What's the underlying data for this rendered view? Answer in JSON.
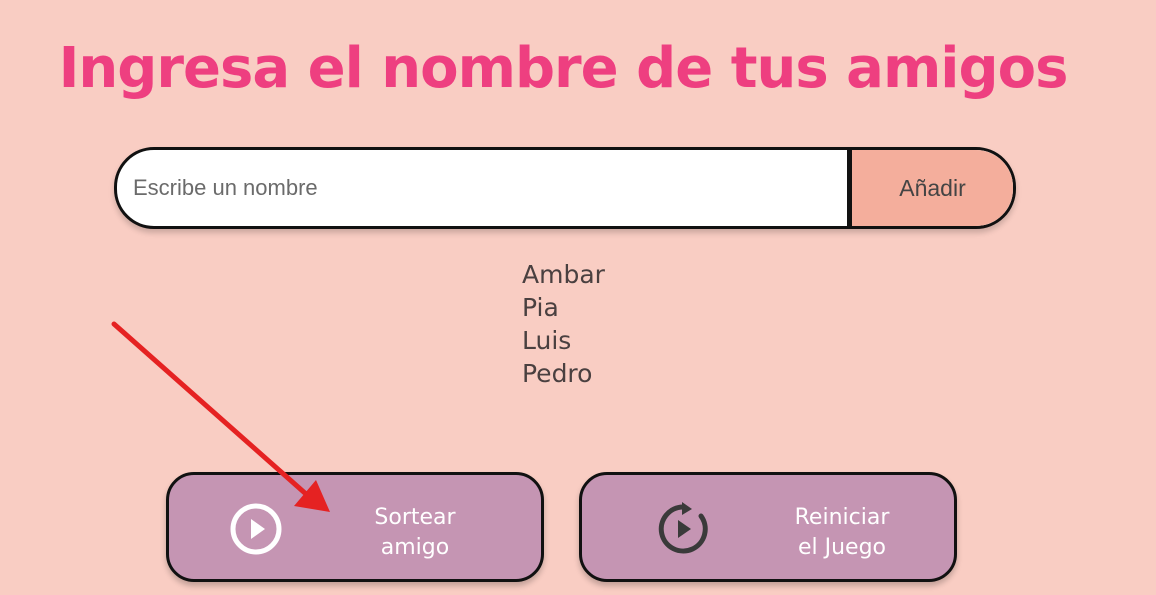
{
  "header": {
    "title": "Ingresa el nombre de tus amigos"
  },
  "form": {
    "placeholder": "Escribe un nombre",
    "value": "",
    "add_label": "Añadir"
  },
  "friends": [
    "Ambar",
    "Pia",
    "Luis",
    "Pedro"
  ],
  "actions": {
    "draw": {
      "line1": "Sortear",
      "line2": "amigo",
      "icon": "play-circle-icon"
    },
    "reset": {
      "line1": "Reiniciar",
      "line2": "el Juego",
      "icon": "restart-icon"
    }
  },
  "annotation": {
    "icon": "red-arrow",
    "color": "#e52222"
  },
  "colors": {
    "background": "#f9cdc3",
    "title": "#ee3f80",
    "add_button": "#f4ae9c",
    "action_button": "#c595b3"
  }
}
